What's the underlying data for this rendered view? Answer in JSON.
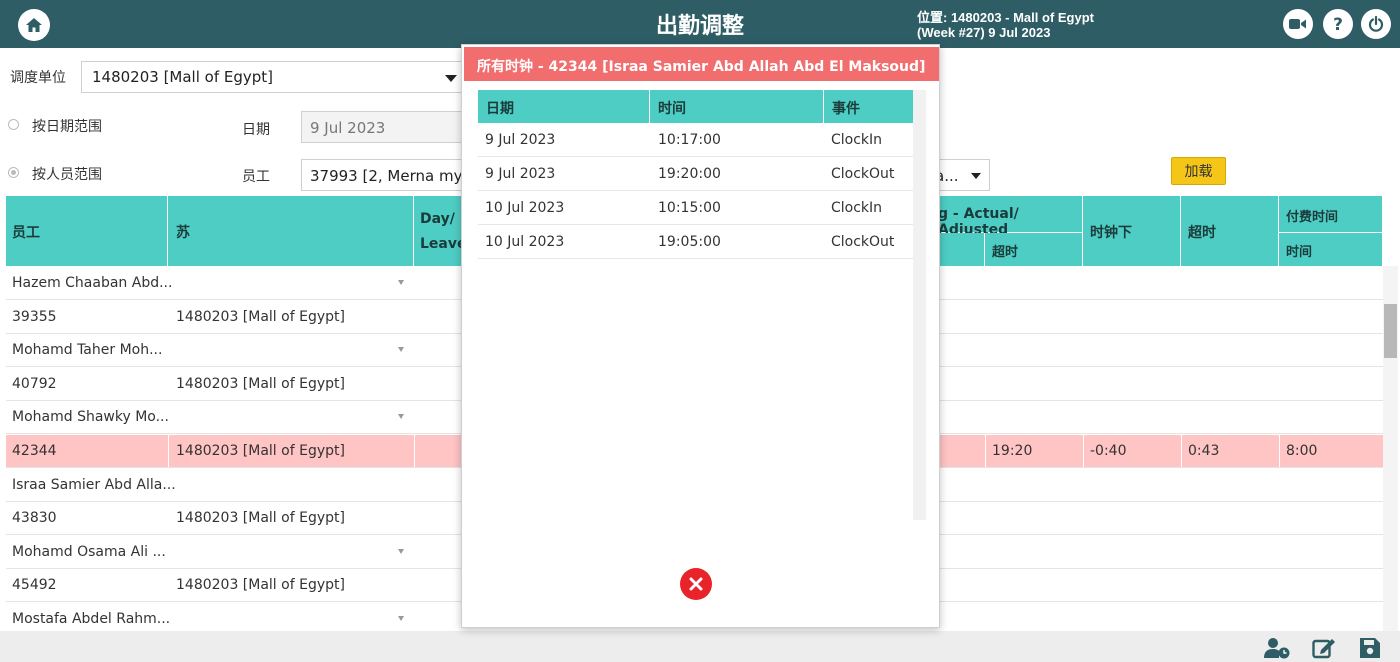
{
  "header": {
    "title": "出勤调整",
    "location_line1": "位置: 1480203  -  Mall of Egypt",
    "location_line2": "(Week #27)  9 Jul 2023",
    "icons": [
      "home-icon",
      "video-camera-icon",
      "help-icon",
      "power-icon"
    ]
  },
  "filters": {
    "unit_label": "调度单位",
    "unit_value": "1480203 [Mall of Egypt]",
    "by_date_label": "按日期范围",
    "date_label": "日期",
    "date_value": "9 Jul 2023",
    "by_staff_label": "按人员范围",
    "employee_label": "员工",
    "employee_value": "37993 [2, Merna mym",
    "right_select_value": "a...",
    "load_label": "加载"
  },
  "grid": {
    "headers": {
      "employee": "员工",
      "su": "苏",
      "day_leave_line1": "Day/",
      "day_leave_line2": "Leave",
      "actual_adjusted": "g - Actual/ Adjusted",
      "overtime_sub": "超时",
      "clock_down": "时钟下",
      "overtime": "超时",
      "paid_time": "付费时间",
      "time_sub": "时间"
    },
    "rows": [
      {
        "c1": "Hazem Chaaban Abd...",
        "c2": "",
        "dropdown": true,
        "highlight": false,
        "v1": "",
        "v2": "",
        "v3": "",
        "v4": ""
      },
      {
        "c1": "39355",
        "c2": "1480203 [Mall of Egypt]",
        "dropdown": false,
        "highlight": false,
        "v1": "",
        "v2": "",
        "v3": "",
        "v4": ""
      },
      {
        "c1": "Mohamd Taher Moh...",
        "c2": "",
        "dropdown": true,
        "highlight": false,
        "v1": "",
        "v2": "",
        "v3": "",
        "v4": ""
      },
      {
        "c1": "40792",
        "c2": "1480203 [Mall of Egypt]",
        "dropdown": false,
        "highlight": false,
        "v1": "",
        "v2": "",
        "v3": "",
        "v4": ""
      },
      {
        "c1": "Mohamd Shawky Mo...",
        "c2": "",
        "dropdown": true,
        "highlight": false,
        "v1": "",
        "v2": "",
        "v3": "",
        "v4": ""
      },
      {
        "c1": "42344",
        "c2": "1480203 [Mall of Egypt]",
        "dropdown": false,
        "highlight": true,
        "v1": "19:20",
        "v2": "-0:40",
        "v3": "0:43",
        "v4": "8:00"
      },
      {
        "c1": "Israa Samier Abd Alla...",
        "c2": "",
        "dropdown": false,
        "highlight": false,
        "v1": "",
        "v2": "",
        "v3": "",
        "v4": ""
      },
      {
        "c1": "43830",
        "c2": "1480203 [Mall of Egypt]",
        "dropdown": false,
        "highlight": false,
        "v1": "",
        "v2": "",
        "v3": "",
        "v4": ""
      },
      {
        "c1": "Mohamd Osama Ali ...",
        "c2": "",
        "dropdown": true,
        "highlight": false,
        "v1": "",
        "v2": "",
        "v3": "",
        "v4": ""
      },
      {
        "c1": "45492",
        "c2": "1480203 [Mall of Egypt]",
        "dropdown": false,
        "highlight": false,
        "v1": "",
        "v2": "",
        "v3": "",
        "v4": ""
      },
      {
        "c1": "Mostafa Abdel Rahm...",
        "c2": "",
        "dropdown": true,
        "highlight": false,
        "v1": "",
        "v2": "",
        "v3": "",
        "v4": ""
      }
    ]
  },
  "popup": {
    "title": "所有时钟 - 42344 [Israa Samier Abd Allah Abd El Maksoud]",
    "headers": {
      "date": "日期",
      "time": "时间",
      "event": "事件"
    },
    "rows": [
      {
        "date": "9 Jul 2023",
        "time": "10:17:00",
        "event": "ClockIn"
      },
      {
        "date": "9 Jul 2023",
        "time": "19:20:00",
        "event": "ClockOut"
      },
      {
        "date": "10 Jul 2023",
        "time": "10:15:00",
        "event": "ClockIn"
      },
      {
        "date": "10 Jul 2023",
        "time": "19:05:00",
        "event": "ClockOut"
      }
    ]
  },
  "footer": {
    "icons": [
      "user-clock-icon",
      "edit-icon",
      "save-icon"
    ]
  },
  "colors": {
    "header_bg": "#2e5d66",
    "table_header_bg": "#4ecdc4",
    "highlight_row": "#ffc4c4",
    "popup_title_bg": "#f26d6d",
    "load_button": "#f5c518",
    "close_button": "#e8232a"
  }
}
